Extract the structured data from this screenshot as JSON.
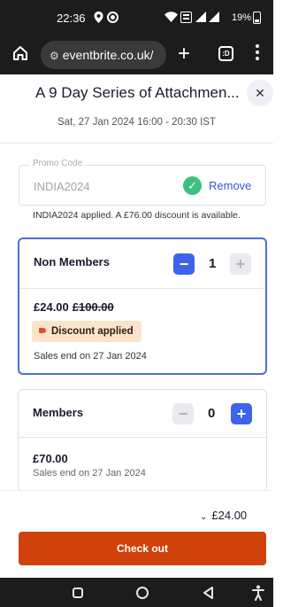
{
  "status_bar": {
    "time": "22:36",
    "battery": "19%"
  },
  "browser": {
    "url": "eventbrite.co.uk/"
  },
  "event": {
    "title": "A 9 Day Series of Attachmen...",
    "datetime": "Sat, 27 Jan 2024 16:00 - 20:30 IST"
  },
  "promo": {
    "label": "Promo Code",
    "value": "INDIA2024",
    "remove_label": "Remove",
    "note": "INDIA2024 applied. A £76.00 discount is available."
  },
  "tickets": [
    {
      "name": "Non Members",
      "quantity": "1",
      "price": "£24.00",
      "original_price": "£100.00",
      "badge": "Discount applied",
      "sales_end": "Sales end on 27 Jan 2024"
    },
    {
      "name": "Members",
      "quantity": "0",
      "price": "£70.00",
      "sales_end": "Sales end on 27 Jan 2024"
    }
  ],
  "footer": {
    "total": "£24.00",
    "checkout_label": "Check out"
  },
  "colors": {
    "accent_blue": "#3d64e6",
    "checkout_orange": "#d1410c",
    "success_green": "#3cc17a",
    "discount_badge_bg": "#fde3c9"
  }
}
